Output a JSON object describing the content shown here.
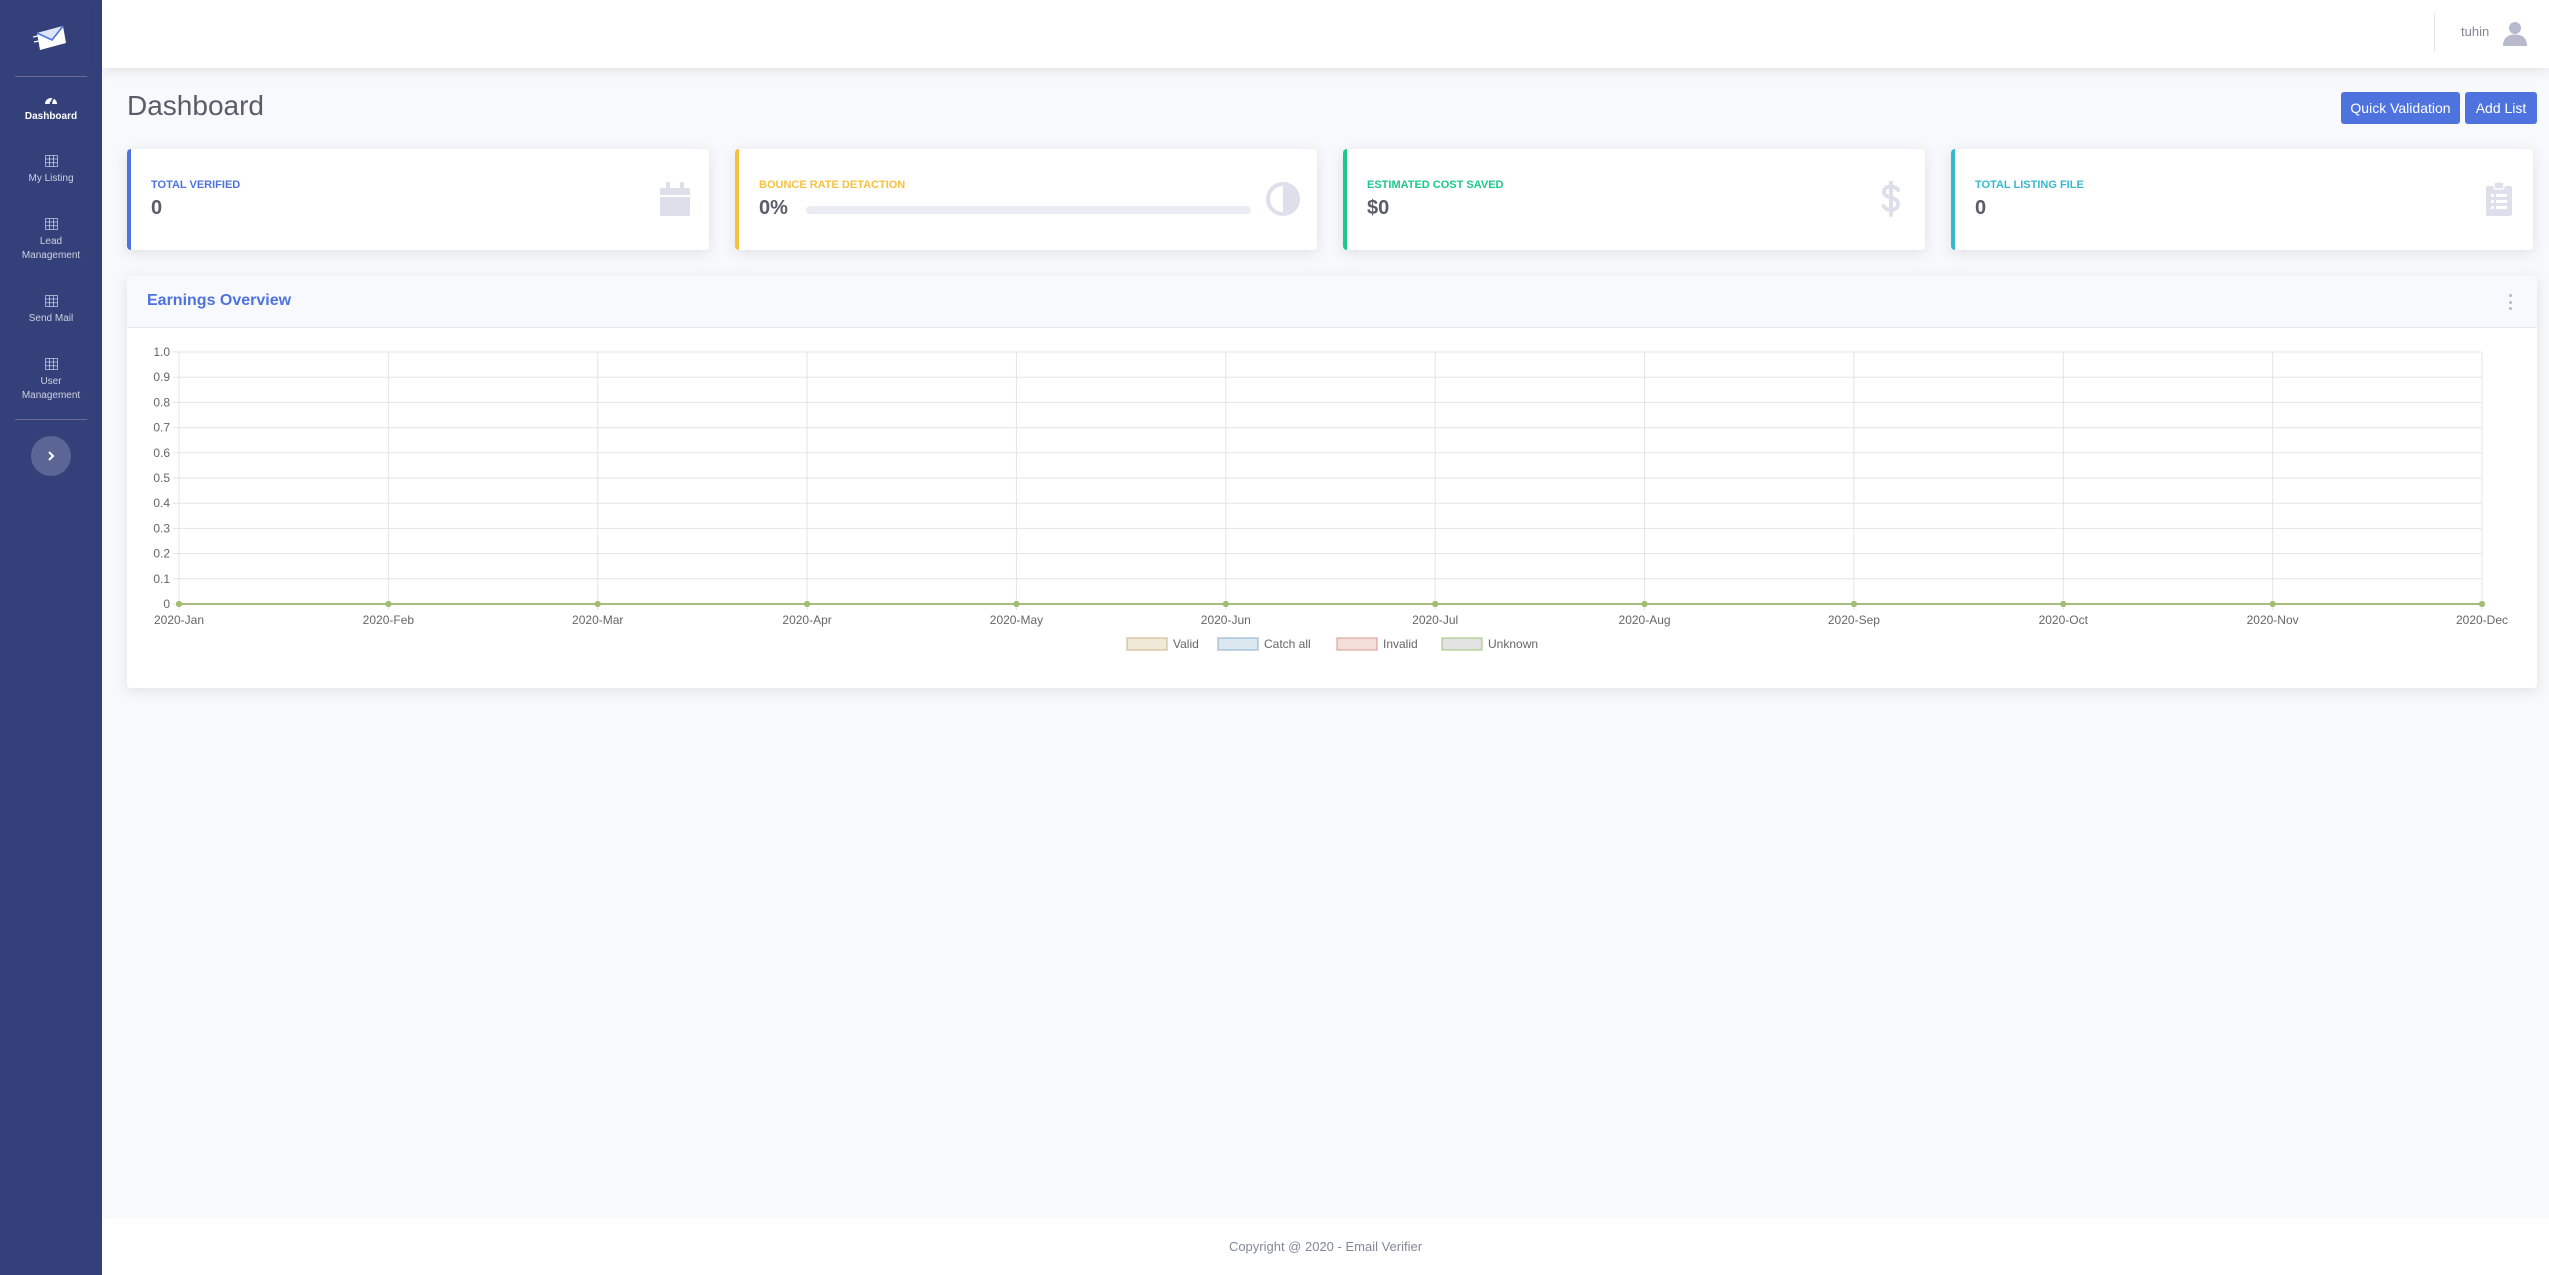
{
  "sidebar": {
    "brand_icon": "envelope-icon",
    "items": [
      {
        "label": "Dashboard",
        "icon": "tachometer-icon",
        "active": true
      },
      {
        "label": "My Listing",
        "icon": "table-icon",
        "active": false
      },
      {
        "label": "Lead Management",
        "icon": "table-icon",
        "active": false
      },
      {
        "label": "Send Mail",
        "icon": "table-icon",
        "active": false
      },
      {
        "label": "User Management",
        "icon": "table-icon",
        "active": false
      }
    ],
    "toggle_icon": "chevron-right-icon"
  },
  "topbar": {
    "user_name": "tuhin",
    "avatar_icon": "user-icon"
  },
  "page": {
    "title": "Dashboard",
    "quick_validation": "Quick Validation",
    "add_list": "Add List"
  },
  "cards": [
    {
      "label": "TOTAL VERIFIED",
      "value": "0",
      "icon": "calendar-icon",
      "color": "#4e73df"
    },
    {
      "label": "BOUNCE RATE DETACTION",
      "value": "0%",
      "icon": "adjust-icon",
      "color": "#f6c23e",
      "progress": 0
    },
    {
      "label": "ESTIMATED COST SAVED",
      "value": "$0",
      "icon": "dollar-icon",
      "color": "#1cc88a"
    },
    {
      "label": "TOTAL LISTING FILE",
      "value": "0",
      "icon": "clipboard-icon",
      "color": "#36b9cc"
    }
  ],
  "earnings": {
    "title": "Earnings Overview",
    "menu_icon": "ellipsis-vertical-icon"
  },
  "chart_data": {
    "type": "line",
    "categories": [
      "2020-Jan",
      "2020-Feb",
      "2020-Mar",
      "2020-Apr",
      "2020-May",
      "2020-Jun",
      "2020-Jul",
      "2020-Aug",
      "2020-Sep",
      "2020-Oct",
      "2020-Nov",
      "2020-Dec"
    ],
    "yticks": [
      "0",
      "0.1",
      "0.2",
      "0.3",
      "0.4",
      "0.5",
      "0.6",
      "0.7",
      "0.8",
      "0.9",
      "1.0"
    ],
    "ylim": [
      0,
      1
    ],
    "grid": true,
    "legend_position": "bottom",
    "series": [
      {
        "name": "Valid",
        "values": [
          0,
          0,
          0,
          0,
          0,
          0,
          0,
          0,
          0,
          0,
          0,
          0
        ],
        "color": "#c5b68a",
        "fill": "#efe9d8"
      },
      {
        "name": "Catch all",
        "values": [
          0,
          0,
          0,
          0,
          0,
          0,
          0,
          0,
          0,
          0,
          0,
          0
        ],
        "color": "#8ab0c9",
        "fill": "#dbe8f0"
      },
      {
        "name": "Invalid",
        "values": [
          0,
          0,
          0,
          0,
          0,
          0,
          0,
          0,
          0,
          0,
          0,
          0
        ],
        "color": "#d49a8a",
        "fill": "#f3dfd9"
      },
      {
        "name": "Unknown",
        "values": [
          0,
          0,
          0,
          0,
          0,
          0,
          0,
          0,
          0,
          0,
          0,
          0
        ],
        "color": "#a0c070",
        "fill": "#e3e3e3"
      }
    ]
  },
  "footer": {
    "text": "Copyright @ 2020 - Email Verifier"
  }
}
